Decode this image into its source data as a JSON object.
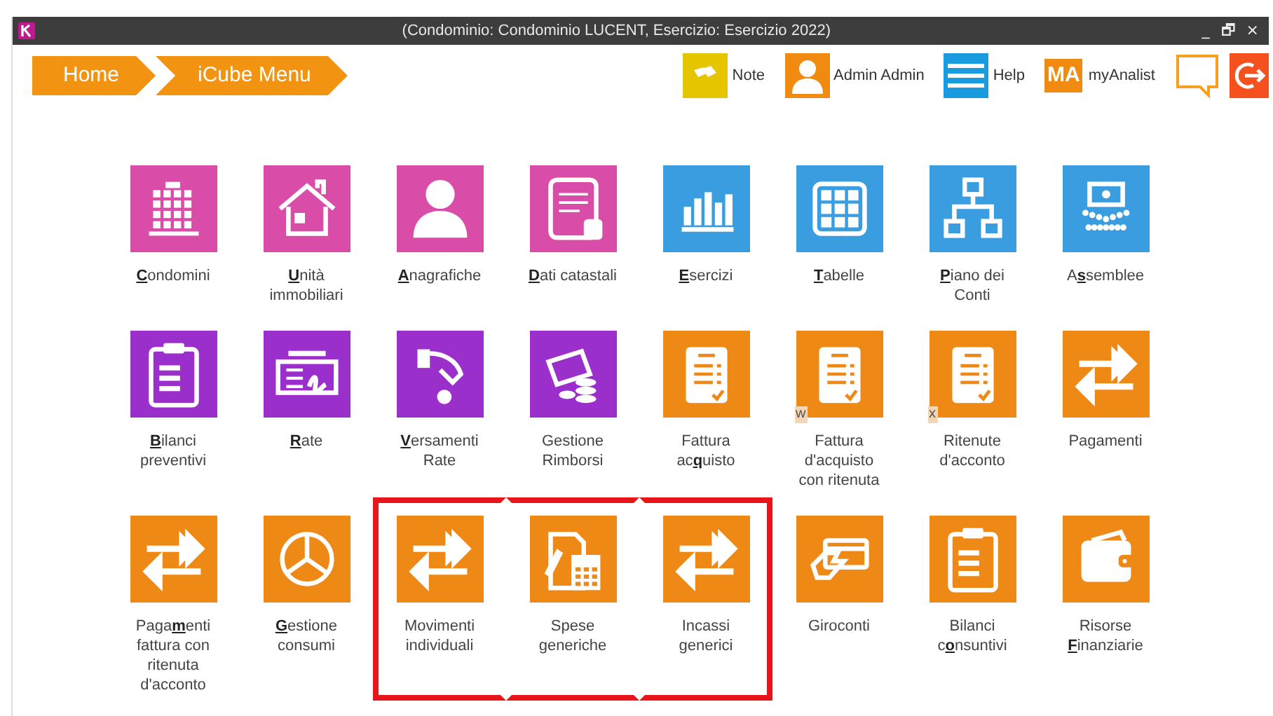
{
  "window": {
    "title": "(Condominio: Condominio LUCENT, Esercizio: Esercizio 2022)",
    "controls": [
      "_",
      "🗗",
      "×"
    ]
  },
  "breadcrumbs": [
    "Home",
    "iCube Menu"
  ],
  "toolbar": {
    "note": "Note",
    "user": "Admin Admin",
    "help": "Help",
    "analist_logo": "MA",
    "analist": "myAnalist"
  },
  "tiles": [
    {
      "label": "**C**ondomini",
      "color": "#d94ca8",
      "highlighted": false
    },
    {
      "label": "**U**nità immobiliari",
      "color": "#d94ca8",
      "highlighted": false
    },
    {
      "label": "**A**nagrafiche",
      "color": "#d94ca8",
      "highlighted": false
    },
    {
      "label": "**D**ati catastali",
      "color": "#d94ca8",
      "highlighted": false
    },
    {
      "label": "**E**sercizi",
      "color": "#3a9de0",
      "highlighted": false
    },
    {
      "label": "**T**abelle",
      "color": "#3a9de0",
      "highlighted": false
    },
    {
      "label": "**P**iano dei Conti",
      "color": "#3a9de0",
      "highlighted": false
    },
    {
      "label": "A**s**semblee",
      "color": "#3a9de0",
      "highlighted": false
    },
    {
      "label": "**B**ilanci preventivi",
      "color": "#9b2fcc",
      "highlighted": false
    },
    {
      "label": "**R**ate",
      "color": "#9b2fcc",
      "highlighted": false
    },
    {
      "label": "**V**ersamenti Rate",
      "color": "#9b2fcc",
      "highlighted": false
    },
    {
      "label": "Gestione Rimborsi",
      "color": "#9b2fcc",
      "highlighted": false
    },
    {
      "label": "Fattura ac**q**uisto",
      "color": "#ee8916",
      "highlighted": false
    },
    {
      "label": "Fattura d'acquisto con ritenuta",
      "color": "#ee8916",
      "highlighted": false,
      "badge": "w"
    },
    {
      "label": "Ritenute d'acconto",
      "color": "#ee8916",
      "highlighted": false,
      "badge": "x"
    },
    {
      "label": "Pagamenti",
      "color": "#ee8916",
      "highlighted": false
    },
    {
      "label": "Paga**m**enti fattura con ritenuta d'acconto",
      "color": "#ee8916",
      "highlighted": false
    },
    {
      "label": "**G**estione consumi",
      "color": "#ee8916",
      "highlighted": false
    },
    {
      "label": "Movimenti individuali",
      "color": "#ee8916",
      "highlighted": true
    },
    {
      "label": "Spese generiche",
      "color": "#ee8916",
      "highlighted": true
    },
    {
      "label": "Incassi generici",
      "color": "#ee8916",
      "highlighted": true
    },
    {
      "label": "Giroconti",
      "color": "#ee8916",
      "highlighted": false
    },
    {
      "label": "Bilanci c**o**nsuntivi",
      "color": "#ee8916",
      "highlighted": false
    },
    {
      "label": "Risorse **F**inanziarie",
      "color": "#ee8916",
      "highlighted": false
    }
  ]
}
